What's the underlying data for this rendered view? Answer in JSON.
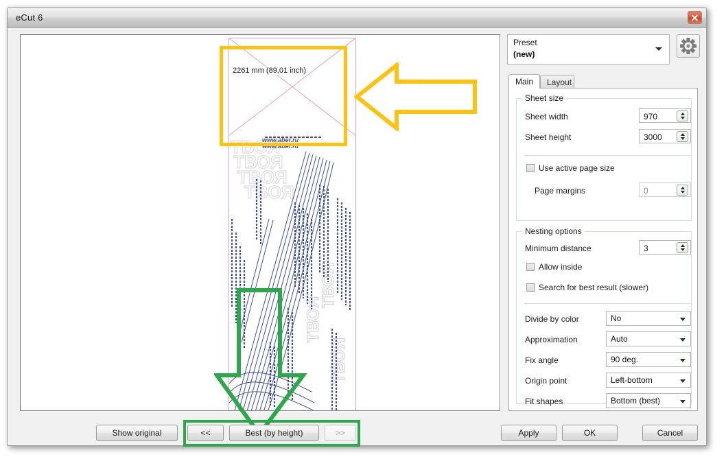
{
  "window": {
    "title": "eCut 6",
    "close_icon": "close-icon"
  },
  "canvas": {
    "sheet_label": "2261 mm (89,01 inch)",
    "sheet_border_color": "#f0a0bb",
    "artwork_color": "#3f4f96"
  },
  "annotations": {
    "yellow_color": "#FFC20E",
    "green_color": "#2CA84A",
    "yellow_rect_name": "highlight-rect-sheet-preview",
    "yellow_arrow_name": "callout-arrow-left",
    "green_arrow_name": "callout-arrow-down",
    "green_rect_name": "highlight-rect-nav-buttons"
  },
  "panel": {
    "preset": {
      "label": "Preset",
      "value": "(new)",
      "dropdown_icon": "chevron-down-icon"
    },
    "settings_icon": "gear-icon",
    "tabs": [
      {
        "label": "Main",
        "active": true
      },
      {
        "label": "Layout",
        "active": false
      }
    ],
    "sheet_size": {
      "title": "Sheet size",
      "fields": [
        {
          "label": "Sheet width",
          "value": "970"
        },
        {
          "label": "Sheet height",
          "value": "3000"
        }
      ],
      "use_active_page_size": {
        "label": "Use active page size",
        "checked": false
      },
      "page_margins": {
        "label": "Page margins",
        "value": "0",
        "disabled": true
      }
    },
    "nesting_options": {
      "title": "Nesting options",
      "minimum_distance": {
        "label": "Minimum distance",
        "value": "3"
      },
      "allow_inside": {
        "label": "Allow inside",
        "checked": false
      },
      "search_best": {
        "label": "Search for best result (slower)",
        "checked": false
      },
      "selects": [
        {
          "label": "Divide by color",
          "value": "No"
        },
        {
          "label": "Approximation",
          "value": "Auto"
        },
        {
          "label": "Fix angle",
          "value": "90 deg."
        },
        {
          "label": "Origin point",
          "value": "Left-bottom"
        },
        {
          "label": "Fit shapes",
          "value": "Bottom (best)"
        }
      ]
    }
  },
  "footer": {
    "show_original": "Show original",
    "prev": "<<",
    "best": "Best (by height)",
    "next": ">>",
    "apply": "Apply",
    "ok": "OK",
    "cancel": "Cancel"
  }
}
